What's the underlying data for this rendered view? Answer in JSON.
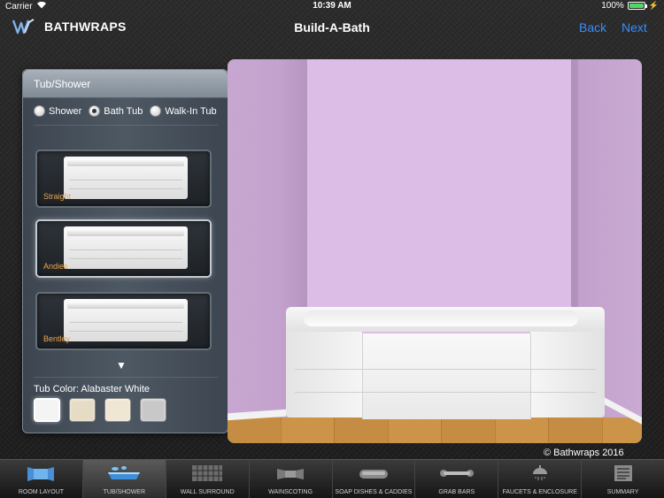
{
  "status_bar": {
    "carrier": "Carrier",
    "time": "10:39 AM",
    "battery": "100%",
    "battery_level": 1.0
  },
  "nav": {
    "brand": "BATHWRAPS",
    "title": "Build-A-Bath",
    "back_label": "Back",
    "next_label": "Next"
  },
  "panel": {
    "title": "Tub/Shower",
    "options": [
      {
        "label": "Shower",
        "selected": false
      },
      {
        "label": "Bath Tub",
        "selected": true
      },
      {
        "label": "Walk-In Tub",
        "selected": false
      }
    ],
    "tubs": [
      {
        "label": "Straight",
        "selected": false
      },
      {
        "label": "Andies",
        "selected": true
      },
      {
        "label": "Bentley",
        "selected": false
      }
    ],
    "scroll_arrow": "▼",
    "color_label": "Tub Color: Alabaster White",
    "swatches": [
      {
        "name": "Alabaster White",
        "hex": "#f4f4f4",
        "selected": true
      },
      {
        "name": "Almond",
        "hex": "#e6dcc6",
        "selected": false
      },
      {
        "name": "Biscuit",
        "hex": "#efe6d4",
        "selected": false
      },
      {
        "name": "Gray",
        "hex": "#c8c8c8",
        "selected": false
      }
    ]
  },
  "scene": {
    "copyright": "© Bathwraps 2016",
    "wall_color": "#dcbde6"
  },
  "tabs": [
    {
      "label": "ROOM LAYOUT",
      "icon": "room-layout-icon",
      "active": false
    },
    {
      "label": "TUB/SHOWER",
      "icon": "tub-icon",
      "active": true
    },
    {
      "label": "WALL SURROUND",
      "icon": "wall-tile-icon",
      "active": false
    },
    {
      "label": "WAINSCOTING",
      "icon": "wainscoting-icon",
      "active": false
    },
    {
      "label": "SOAP DISHES & CADDIES",
      "icon": "soap-dish-icon",
      "active": false
    },
    {
      "label": "GRAB BARS",
      "icon": "grab-bar-icon",
      "active": false
    },
    {
      "label": "FAUCETS & ENCLOSURE",
      "icon": "shower-head-icon",
      "active": false
    },
    {
      "label": "SUMMARY",
      "icon": "summary-icon",
      "active": false
    }
  ]
}
